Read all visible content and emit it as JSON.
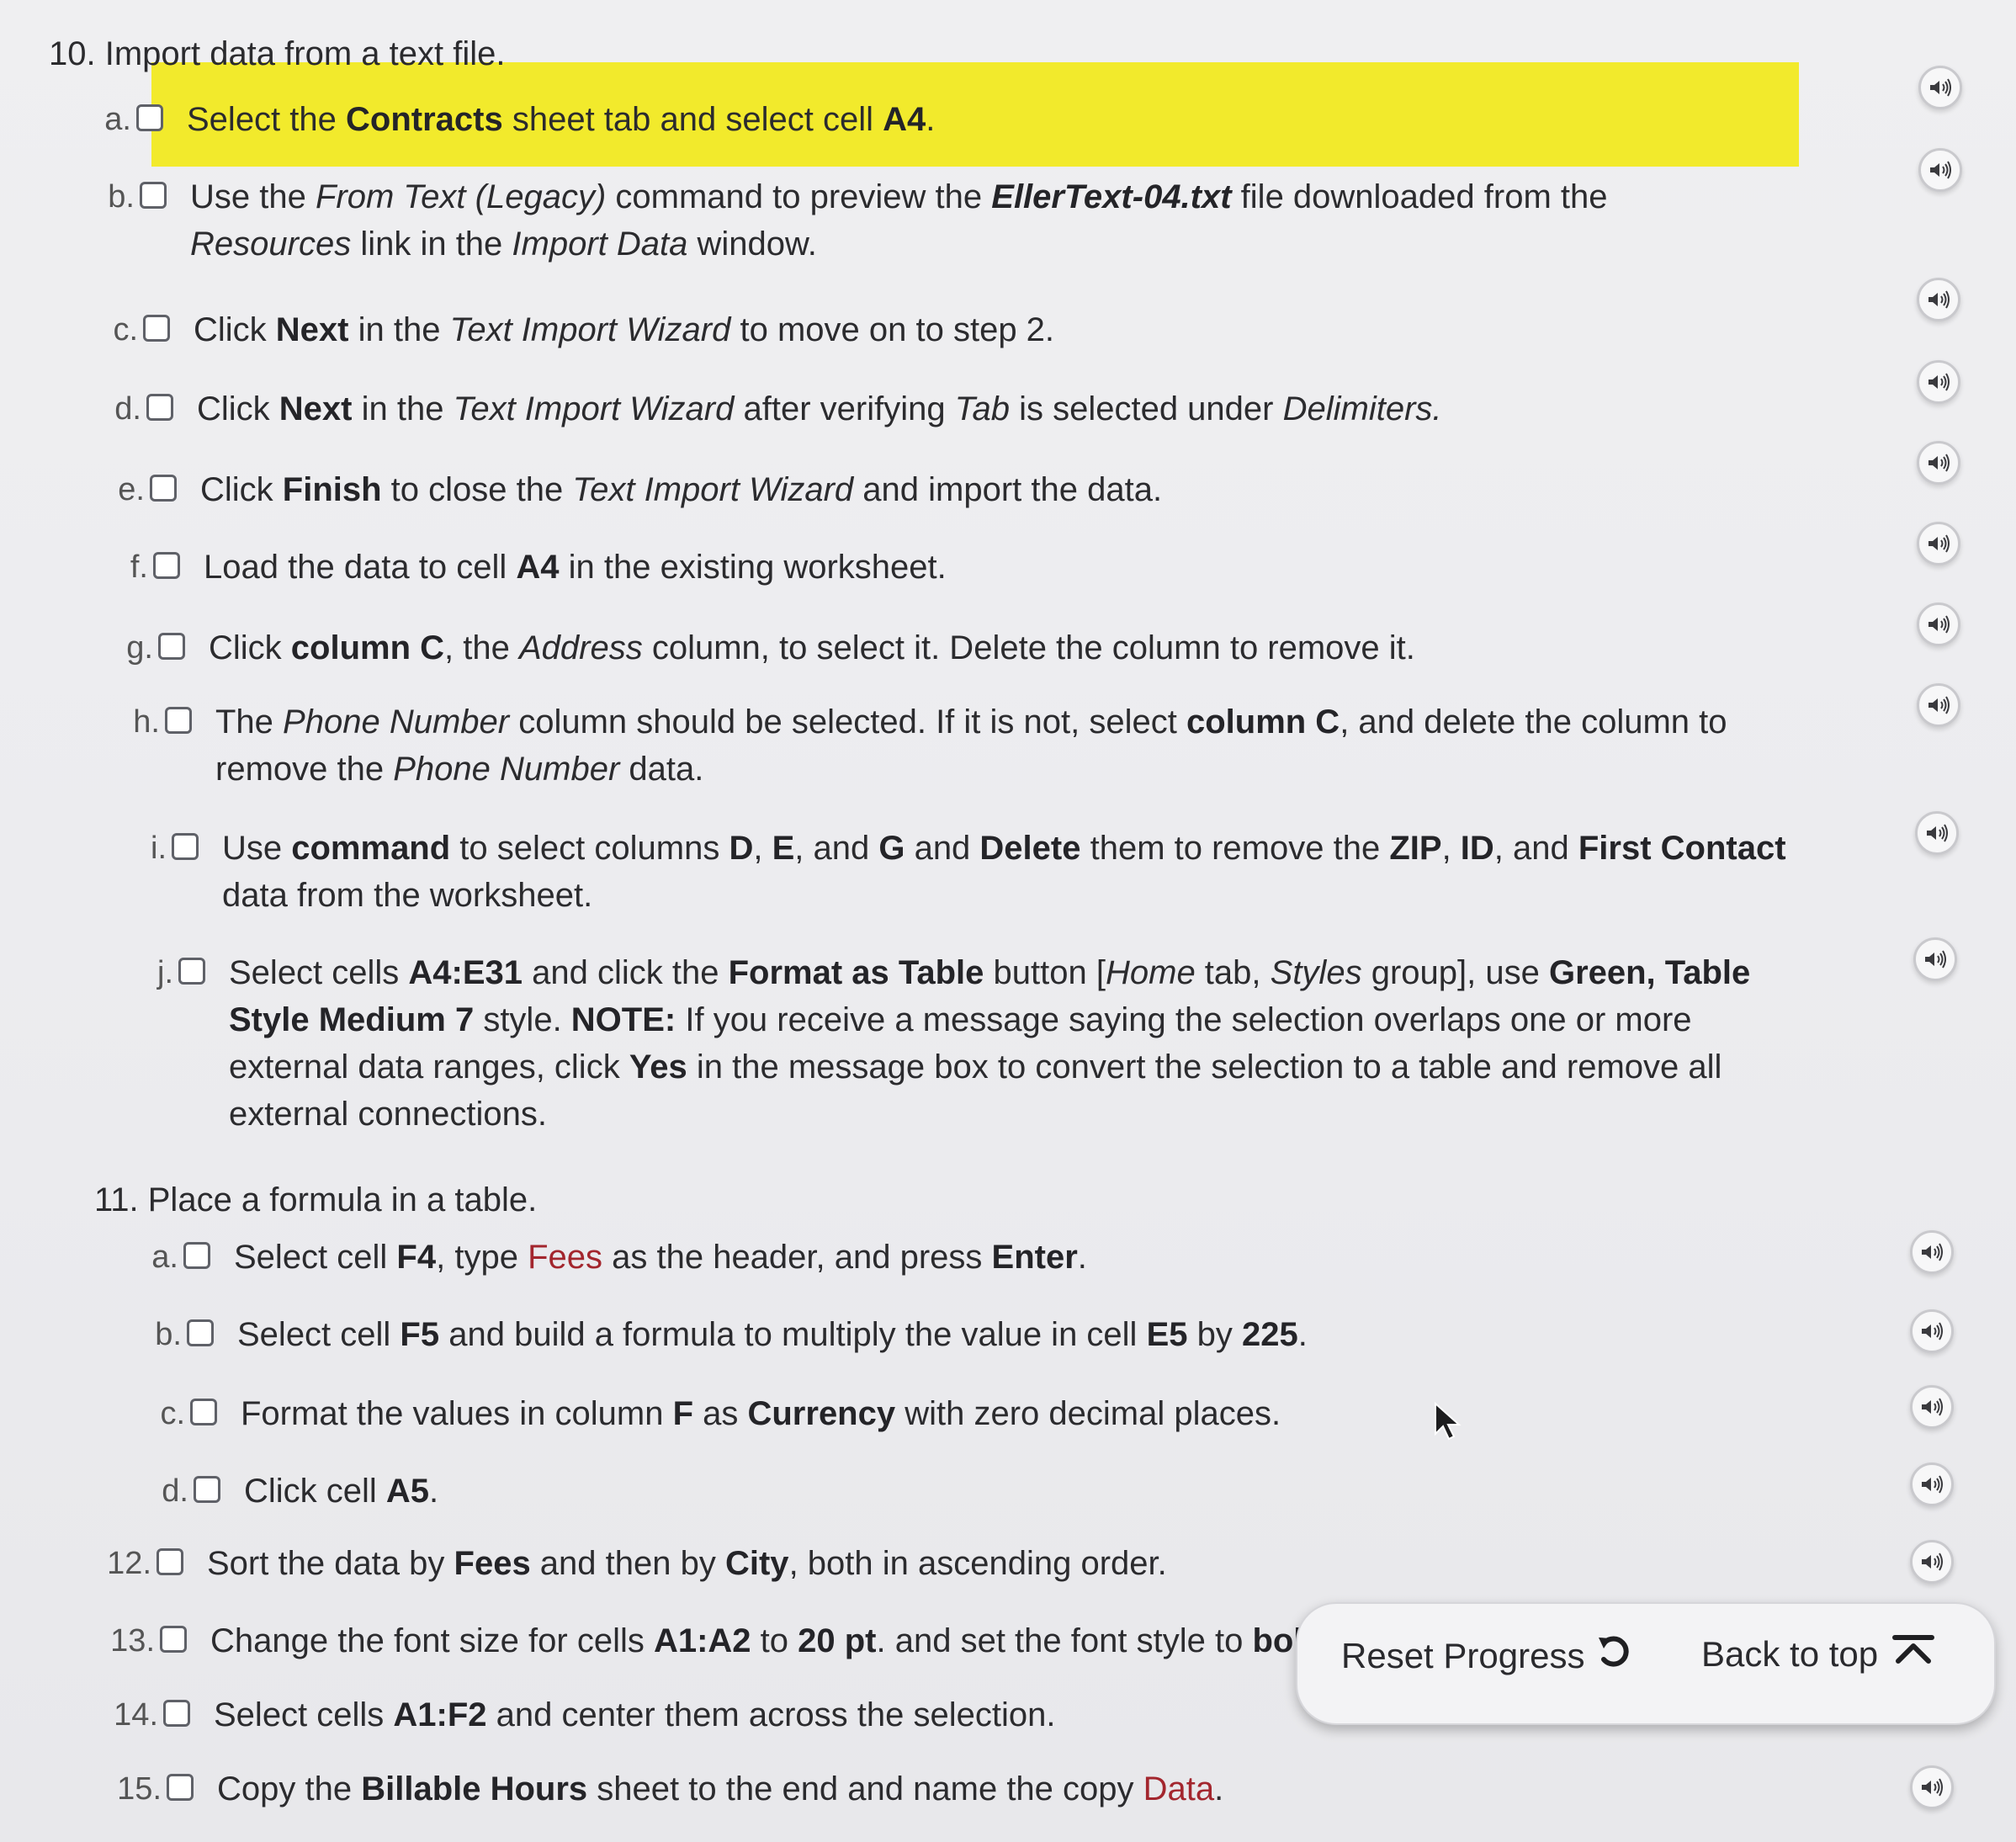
{
  "section10": {
    "title": "10. Import data from a text file.",
    "items": [
      {
        "letter": "a.",
        "html": "Select the <b>Contracts</b> sheet tab and select cell <b>A4</b>."
      },
      {
        "letter": "b.",
        "html": "Use the <i>From Text (Legacy)</i> command to preview the <b><i>EllerText-04.txt</i></b> file downloaded from the<br><i>Resources</i> link in the <i>Import Data</i> window."
      },
      {
        "letter": "c.",
        "html": "Click <b>Next</b> in the <i>Text Import Wizard</i> to move on to step 2."
      },
      {
        "letter": "d.",
        "html": "Click <b>Next</b> in the <i>Text Import Wizard</i> after verifying <i>Tab</i> is selected under <i>Delimiters.</i>"
      },
      {
        "letter": "e.",
        "html": "Click <b>Finish</b> to close the <i>Text Import Wizard</i> and import the data."
      },
      {
        "letter": "f.",
        "html": "Load the data to cell <b>A4</b> in the existing worksheet."
      },
      {
        "letter": "g.",
        "html": "Click <b>column C</b>, the <i>Address</i> column, to select it. Delete the column to remove it."
      },
      {
        "letter": "h.",
        "html": "The <i>Phone Number</i> column should be selected. If it is not, select <b>column C</b>, and delete the column to<br>remove the <i>Phone Number</i> data."
      },
      {
        "letter": "i.",
        "html": "Use <b>command</b> to select columns <b>D</b>, <b>E</b>, and <b>G</b> and <b>Delete</b> them to remove the <b>ZIP</b>, <b>ID</b>, and <b>First Contact</b><br>data from the worksheet."
      },
      {
        "letter": "j.",
        "html": "Select cells <b>A4:E31</b> and click the <b>Format as Table</b> button [<i>Home</i> tab, <i>Styles</i> group], use <b>Green, Table</b><br><b>Style Medium 7</b> style. <b>NOTE:</b> If you receive a message saying the selection overlaps one or more<br>external data ranges, click <b>Yes</b> in the message box to convert the selection to a table and remove all<br>external connections."
      }
    ]
  },
  "section11": {
    "title": "11. Place a formula in a table.",
    "items": [
      {
        "letter": "a.",
        "html": "Select cell <b>F4</b>, type <span class=\"red\">Fees</span> as the header, and press <b>Enter</b>."
      },
      {
        "letter": "b.",
        "html": "Select cell <b>F5</b> and build a formula to multiply the value in cell <b>E5</b> by <b>225</b>."
      },
      {
        "letter": "c.",
        "html": "Format the values in column <b>F</b> as <b>Currency</b> with zero decimal places."
      },
      {
        "letter": "d.",
        "html": "Click cell <b>A5</b>."
      }
    ]
  },
  "steps": [
    {
      "number": "12.",
      "html": "Sort the data by <b>Fees</b> and then by <b>City</b>, both in ascending order."
    },
    {
      "number": "13.",
      "html": "Change the font size for cells <b>A1:A2</b> to <b>20 pt</b>. and set the font style to <b>bold</b>."
    },
    {
      "number": "14.",
      "html": "Select cells <b>A1:F2</b> and center them across the selection."
    },
    {
      "number": "15.",
      "html": "Copy the <b>Billable Hours</b> sheet to the end and name the copy <span class=\"red\">Data</span>."
    }
  ],
  "footer": {
    "reset_label": "Reset Progress",
    "back_label": "Back to top"
  },
  "icons": {
    "speaker": "speaker-audio-icon",
    "reset": "reset-arrow-icon",
    "back_to_top": "back-to-top-icon",
    "cursor": "mouse-pointer-icon"
  },
  "colors": {
    "highlight": "#f2ea2c",
    "accent_text": "#a3262e",
    "background": "#ececef"
  }
}
